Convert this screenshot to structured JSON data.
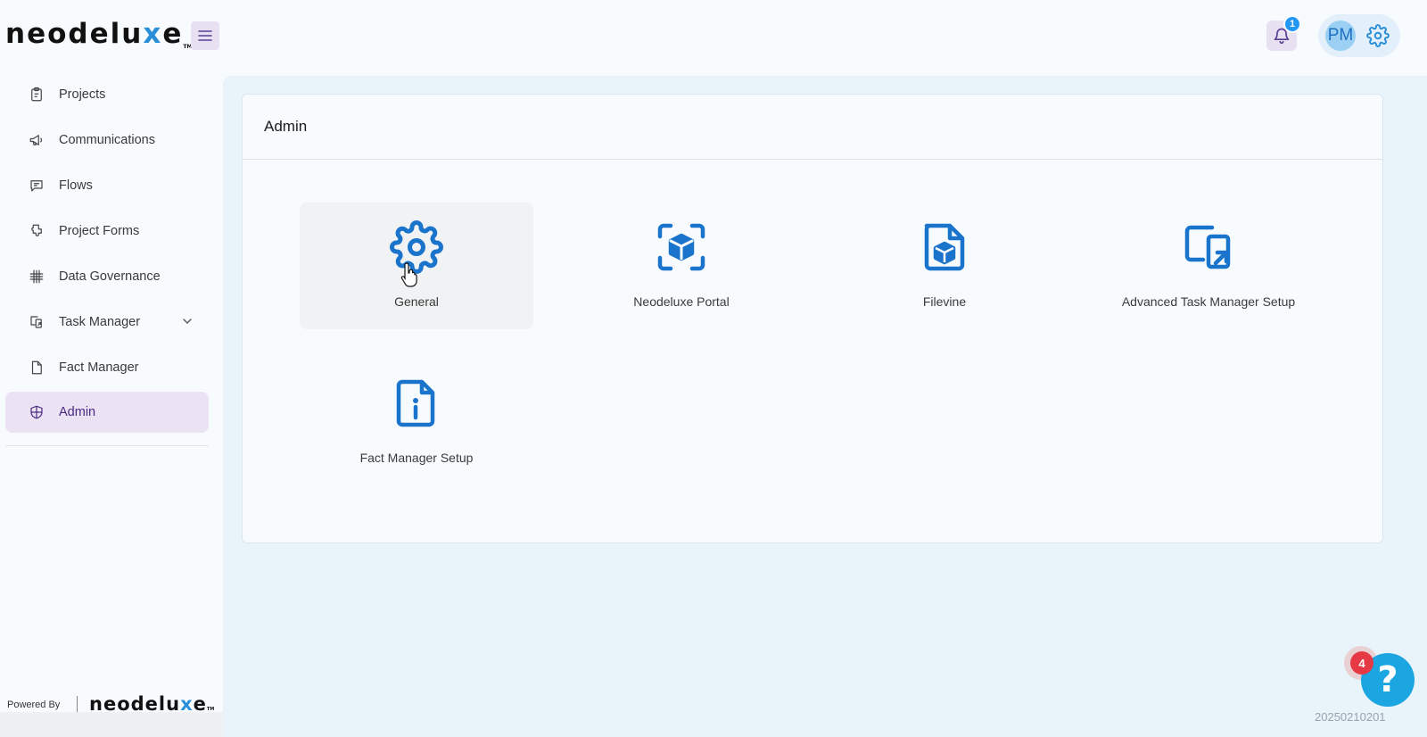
{
  "brand": {
    "name_pre": "neode",
    "name_mid": "lu",
    "name_x": "x",
    "name_post": "e",
    "tm": "TM",
    "accent": "#2a8fd8"
  },
  "header": {
    "notification_count": "1",
    "avatar_initials": "PM"
  },
  "sidebar": {
    "items": [
      {
        "label": "Projects",
        "icon": "clipboard-icon"
      },
      {
        "label": "Communications",
        "icon": "megaphone-icon"
      },
      {
        "label": "Flows",
        "icon": "chat-bubble-icon"
      },
      {
        "label": "Project Forms",
        "icon": "puzzle-icon"
      },
      {
        "label": "Data Governance",
        "icon": "grid-hash-icon"
      },
      {
        "label": "Task Manager",
        "icon": "task-export-icon"
      },
      {
        "label": "Fact Manager",
        "icon": "document-icon"
      },
      {
        "label": "Admin",
        "icon": "shield-icon",
        "active": true
      }
    ],
    "powered_by": "Powered By"
  },
  "main": {
    "title": "Admin",
    "tiles": [
      {
        "label": "General",
        "icon": "gear-icon"
      },
      {
        "label": "Neodeluxe Portal",
        "icon": "cube-scan-icon"
      },
      {
        "label": "Filevine",
        "icon": "file-cube-icon"
      },
      {
        "label": "Advanced Task Manager Setup",
        "icon": "window-export-icon"
      },
      {
        "label": "Fact Manager Setup",
        "icon": "file-info-icon"
      }
    ]
  },
  "help": {
    "badge_count": "4",
    "symbol": "?"
  },
  "version": "20250210201"
}
